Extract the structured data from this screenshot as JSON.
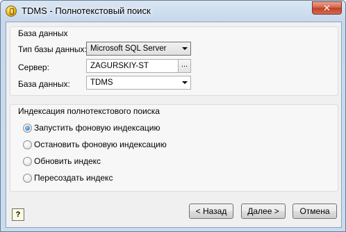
{
  "window": {
    "title": "TDMS - Полнотекстовый поиск",
    "close_label": "✕"
  },
  "database_group": {
    "title": "База данных",
    "type_label": "Тип базы данных:",
    "type_value": "Microsoft SQL Server",
    "server_label": "Сервер:",
    "server_value": "ZAGURSKIY-ST",
    "browse_label": "...",
    "db_label": "База данных:",
    "db_value": "TDMS"
  },
  "indexing_group": {
    "title": "Индексация полнотекстового поиска",
    "options": [
      {
        "label": "Запустить фоновую индексацию",
        "checked": true
      },
      {
        "label": "Остановить фоновую индексацию",
        "checked": false
      },
      {
        "label": "Обновить индекс",
        "checked": false
      },
      {
        "label": "Пересоздать индекс",
        "checked": false
      }
    ]
  },
  "footer": {
    "help_label": "?",
    "back_label": "< Назад",
    "next_label": "Далее >",
    "cancel_label": "Отмена"
  }
}
